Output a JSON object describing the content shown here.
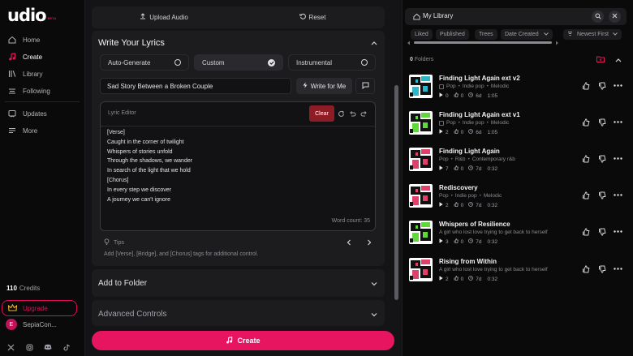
{
  "sidebar": {
    "logo": "udio",
    "beta": "BETA",
    "nav": [
      {
        "label": "Home",
        "icon": "home-icon"
      },
      {
        "label": "Create",
        "icon": "music-note-icon"
      },
      {
        "label": "Library",
        "icon": "library-icon"
      },
      {
        "label": "Following",
        "icon": "following-icon"
      },
      {
        "label": "Updates",
        "icon": "updates-icon"
      },
      {
        "label": "More",
        "icon": "menu-icon"
      }
    ],
    "credits_count": "110",
    "credits_label": "Credits",
    "upgrade_label": "Upgrade",
    "user_initial": "E",
    "user_name": "SepiaCon..."
  },
  "center": {
    "upload_label": "Upload Audio",
    "reset_label": "Reset",
    "lyrics_section_title": "Write Your Lyrics",
    "options": [
      "Auto-Generate",
      "Custom",
      "Instrumental"
    ],
    "selected_option": "Custom",
    "title_value": "Sad Story Between a Broken Couple",
    "write_for_me_label": "Write for Me",
    "editor_title": "Lyric Editor",
    "clear_label": "Clear",
    "lyrics": "[Verse]\nCaught in the corner of twilight\nWhispers of stories unfold\nThrough the shadows, we wander\nIn search of the light that we hold\n[Chorus]\nIn every step we discover\nA journey we can't ignore",
    "word_count": "Word count: 35",
    "tips_label": "Tips",
    "tip_text": "Add [Verse], [Bridge], and [Chorus] tags for additional control.",
    "add_to_folder": "Add to Folder",
    "advanced_controls": "Advanced Controls",
    "create_label": "Create"
  },
  "library": {
    "title": "My Library",
    "filters": [
      "Liked",
      "Published",
      "Trees",
      "Date Created",
      "Newest First"
    ],
    "folders_count": "0",
    "folders_label": "Folders",
    "songs": [
      {
        "title": "Finding Light Again ext v2",
        "tags": [
          "Pop",
          "Indie pop",
          "Melodic"
        ],
        "has_tag_icon": true,
        "plays": "0",
        "likes": "0",
        "age": "6d",
        "duration": "1:05",
        "thumb_color": "#2ab7c9"
      },
      {
        "title": "Finding Light Again ext v1",
        "tags": [
          "Pop",
          "Indie pop",
          "Melodic"
        ],
        "has_tag_icon": true,
        "plays": "2",
        "likes": "0",
        "age": "6d",
        "duration": "1:05",
        "thumb_color": "#5fd83a"
      },
      {
        "title": "Finding Light Again",
        "tags": [
          "Pop",
          "R&b",
          "Contemporary r&b"
        ],
        "has_tag_icon": false,
        "plays": "7",
        "likes": "0",
        "age": "7d",
        "duration": "0:32",
        "thumb_color": "#e0406a"
      },
      {
        "title": "Rediscovery",
        "tags": [
          "Pop",
          "Indie pop",
          "Melodic"
        ],
        "has_tag_icon": false,
        "plays": "2",
        "likes": "0",
        "age": "7d",
        "duration": "0:32",
        "thumb_color": "#e0406a"
      },
      {
        "title": "Whispers of Resilience",
        "subtitle": "A girl who lost love trying to get back to herself",
        "plays": "3",
        "likes": "0",
        "age": "7d",
        "duration": "0:32",
        "thumb_color": "#5fd83a"
      },
      {
        "title": "Rising from Within",
        "subtitle": "A girl who lost love trying to get back to herself",
        "plays": "2",
        "likes": "0",
        "age": "7d",
        "duration": "0:32",
        "thumb_color": "#e0406a"
      }
    ]
  },
  "colors": {
    "accent": "#e7155f",
    "clear": "#8f1c24",
    "bg": "#0a0a0a",
    "panel": "#1c1c1f"
  }
}
